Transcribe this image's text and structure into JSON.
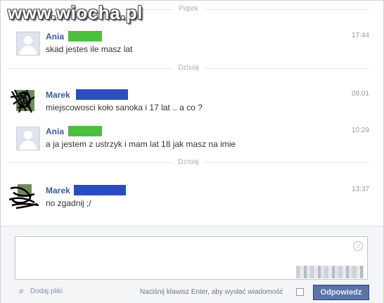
{
  "watermark": {
    "text": "www.wiocha.pl"
  },
  "dividers": [
    {
      "label": "Piątek"
    },
    {
      "label": "Dzisiaj"
    },
    {
      "label": "Dzisiaj"
    }
  ],
  "messages": [
    {
      "author": "Ania",
      "time": "17:44",
      "text": "skad jestes ile masz lat",
      "redaction_color": "#4cbf3f",
      "avatar": "default-avatar"
    },
    {
      "author": "Marek",
      "time": "09:01",
      "text": "miejscowosci koło sanoka i 17 lat .. a co ?",
      "redaction_color": "#2b4dbf",
      "avatar": "scribbled-photo"
    },
    {
      "author": "Ania",
      "time": "10:29",
      "text": "a ja jestem z ustrzyk i mam lat 18 jak masz na imie",
      "redaction_color": "#4cbf3f",
      "avatar": "default-avatar"
    },
    {
      "author": "Marek",
      "time": "13:37",
      "text": "no zgadnij ;/",
      "redaction_color": "#2b4dbf",
      "avatar": "scribbled-photo"
    }
  ],
  "composer": {
    "attach_label": "Dodaj pliki",
    "enter_hint": "Naciśnij klawisz Enter, aby wysłać wiadomość",
    "reply_label": "Odpowiedz",
    "emoji_icon": "smiley-icon",
    "attach_icon": "paperclip-icon"
  },
  "colors": {
    "name_link": "#3b5998",
    "button": "#5b74a8"
  }
}
